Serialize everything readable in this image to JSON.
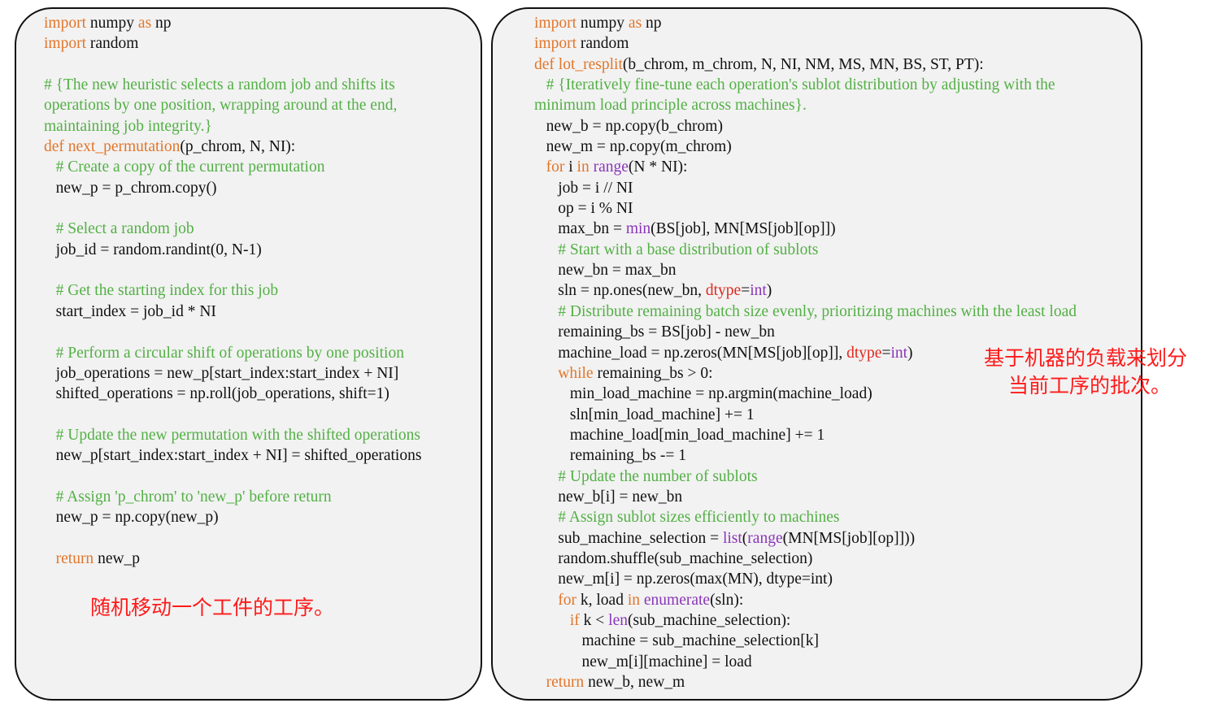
{
  "colors": {
    "keyword": "#e2762a",
    "comment": "#53b045",
    "builtin": "#8a36b8",
    "param": "#e0281e",
    "annotation": "#ff1a1a",
    "panel_bg": "#f2f2f2",
    "text": "#111111"
  },
  "left": {
    "lines": [
      [
        {
          "t": "import",
          "c": "kw"
        },
        {
          "t": " numpy "
        },
        {
          "t": "as",
          "c": "kw"
        },
        {
          "t": " np"
        }
      ],
      [
        {
          "t": "import",
          "c": "kw"
        },
        {
          "t": " random"
        }
      ],
      [],
      [
        {
          "t": "# {The new heuristic selects a random job and shifts its",
          "c": "cm"
        }
      ],
      [
        {
          "t": "operations by one position, wrapping around at the end,",
          "c": "cm"
        }
      ],
      [
        {
          "t": "maintaining job integrity.}",
          "c": "cm"
        }
      ],
      [
        {
          "t": "def",
          "c": "kw"
        },
        {
          "t": " "
        },
        {
          "t": "next_permutation",
          "c": "kw"
        },
        {
          "t": "(p_chrom, N, NI):"
        }
      ],
      [
        {
          "t": "   "
        },
        {
          "t": "# Create a copy of the current permutation",
          "c": "cm"
        }
      ],
      [
        {
          "t": "   new_p = p_chrom.copy()"
        }
      ],
      [],
      [
        {
          "t": "   "
        },
        {
          "t": "# Select a random job",
          "c": "cm"
        }
      ],
      [
        {
          "t": "   job_id = random.randint(0, N-1)"
        }
      ],
      [],
      [
        {
          "t": "   "
        },
        {
          "t": "# Get the starting index for this job",
          "c": "cm"
        }
      ],
      [
        {
          "t": "   start_index = job_id * NI"
        }
      ],
      [],
      [
        {
          "t": "   "
        },
        {
          "t": "# Perform a circular shift of operations by one position",
          "c": "cm"
        }
      ],
      [
        {
          "t": "   job_operations = new_p[start_index:start_index + NI]"
        }
      ],
      [
        {
          "t": "   shifted_operations = np.roll(job_operations, shift=1)"
        }
      ],
      [],
      [
        {
          "t": "   "
        },
        {
          "t": "# Update the new permutation with the shifted operations",
          "c": "cm"
        }
      ],
      [
        {
          "t": "   new_p[start_index:start_index + NI] = shifted_operations"
        }
      ],
      [],
      [
        {
          "t": "   "
        },
        {
          "t": "# Assign 'p_chrom' to 'new_p' before return",
          "c": "cm"
        }
      ],
      [
        {
          "t": "   new_p = np.copy(new_p)"
        }
      ],
      [],
      [
        {
          "t": "   "
        },
        {
          "t": "return",
          "c": "kw"
        },
        {
          "t": " new_p"
        }
      ]
    ],
    "annotation": "随机移动一个工件的工序。"
  },
  "right": {
    "lines": [
      [
        {
          "t": "import",
          "c": "kw"
        },
        {
          "t": " numpy "
        },
        {
          "t": "as",
          "c": "kw"
        },
        {
          "t": " np"
        }
      ],
      [
        {
          "t": "import",
          "c": "kw"
        },
        {
          "t": " random"
        }
      ],
      [
        {
          "t": "def",
          "c": "kw"
        },
        {
          "t": " "
        },
        {
          "t": "lot_resplit",
          "c": "kw"
        },
        {
          "t": "(b_chrom, m_chrom, N, NI, NM, MS, MN, BS, ST, PT):"
        }
      ],
      [
        {
          "t": "   "
        },
        {
          "t": "# {Iteratively fine-tune each operation's sublot distribution by adjusting with the",
          "c": "cm"
        }
      ],
      [
        {
          "t": "minimum load principle across machines}.",
          "c": "cm"
        }
      ],
      [
        {
          "t": "   new_b = np.copy(b_chrom)"
        }
      ],
      [
        {
          "t": "   new_m = np.copy(m_chrom)"
        }
      ],
      [
        {
          "t": "   "
        },
        {
          "t": "for",
          "c": "kw"
        },
        {
          "t": " i "
        },
        {
          "t": "in",
          "c": "kw"
        },
        {
          "t": " "
        },
        {
          "t": "range",
          "c": "bi"
        },
        {
          "t": "(N * NI):"
        }
      ],
      [
        {
          "t": "      job = i // NI"
        }
      ],
      [
        {
          "t": "      op = i % NI"
        }
      ],
      [
        {
          "t": "      max_bn = "
        },
        {
          "t": "min",
          "c": "bi"
        },
        {
          "t": "(BS[job], MN[MS[job][op]])"
        }
      ],
      [
        {
          "t": "      "
        },
        {
          "t": "# Start with a base distribution of sublots",
          "c": "cm"
        }
      ],
      [
        {
          "t": "      new_bn = max_bn"
        }
      ],
      [
        {
          "t": "      sln = np.ones(new_bn, "
        },
        {
          "t": "dtype",
          "c": "rd"
        },
        {
          "t": "="
        },
        {
          "t": "int",
          "c": "bi"
        },
        {
          "t": ")"
        }
      ],
      [
        {
          "t": "      "
        },
        {
          "t": "# Distribute remaining batch size evenly, prioritizing machines with the least load",
          "c": "cm"
        }
      ],
      [
        {
          "t": "      remaining_bs = BS[job] - new_bn"
        }
      ],
      [
        {
          "t": "      machine_load = np.zeros(MN[MS[job][op]], "
        },
        {
          "t": "dtype",
          "c": "rd"
        },
        {
          "t": "="
        },
        {
          "t": "int",
          "c": "bi"
        },
        {
          "t": ")"
        }
      ],
      [
        {
          "t": "      "
        },
        {
          "t": "while",
          "c": "kw"
        },
        {
          "t": " remaining_bs > 0:"
        }
      ],
      [
        {
          "t": "         min_load_machine = np.argmin(machine_load)"
        }
      ],
      [
        {
          "t": "         sln[min_load_machine] += 1"
        }
      ],
      [
        {
          "t": "         machine_load[min_load_machine] += 1"
        }
      ],
      [
        {
          "t": "         remaining_bs -= 1"
        }
      ],
      [
        {
          "t": "      "
        },
        {
          "t": "# Update the number of sublots",
          "c": "cm"
        }
      ],
      [
        {
          "t": "      new_b[i] = new_bn"
        }
      ],
      [
        {
          "t": "      "
        },
        {
          "t": "# Assign sublot sizes efficiently to machines",
          "c": "cm"
        }
      ],
      [
        {
          "t": "      sub_machine_selection = "
        },
        {
          "t": "list",
          "c": "bi"
        },
        {
          "t": "("
        },
        {
          "t": "range",
          "c": "bi"
        },
        {
          "t": "(MN[MS[job][op]]))"
        }
      ],
      [
        {
          "t": "      random.shuffle(sub_machine_selection)"
        }
      ],
      [
        {
          "t": "      new_m[i] = np.zeros(max(MN), dtype=int)"
        }
      ],
      [
        {
          "t": "      "
        },
        {
          "t": "for",
          "c": "kw"
        },
        {
          "t": " k, load "
        },
        {
          "t": "in",
          "c": "kw"
        },
        {
          "t": " "
        },
        {
          "t": "enumerate",
          "c": "bi"
        },
        {
          "t": "(sln):"
        }
      ],
      [
        {
          "t": "         "
        },
        {
          "t": "if",
          "c": "kw"
        },
        {
          "t": " k < "
        },
        {
          "t": "len",
          "c": "bi"
        },
        {
          "t": "(sub_machine_selection):"
        }
      ],
      [
        {
          "t": "            machine = sub_machine_selection[k]"
        }
      ],
      [
        {
          "t": "            new_m[i][machine] = load"
        }
      ],
      [
        {
          "t": "   "
        },
        {
          "t": "return",
          "c": "kw"
        },
        {
          "t": " new_b, new_m"
        }
      ]
    ],
    "annotation_line1": "基于机器的负载来划分",
    "annotation_line2": "当前工序的批次。"
  }
}
